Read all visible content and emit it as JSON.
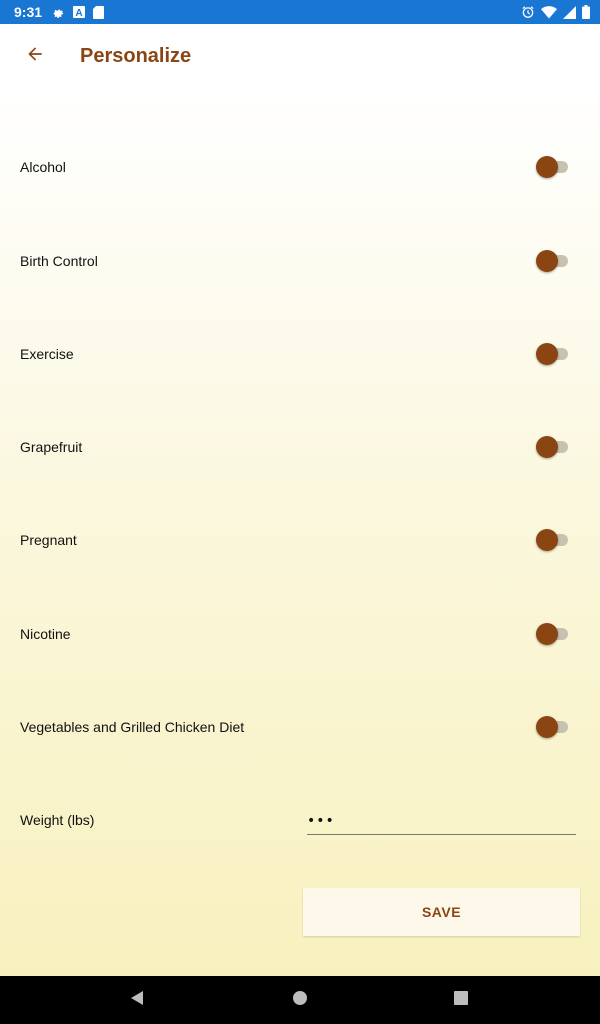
{
  "status_bar": {
    "time": "9:31",
    "left_icons": [
      "gear-icon",
      "a-badge-icon",
      "sd-card-icon"
    ],
    "right_icons": [
      "alarm-icon",
      "wifi-icon",
      "cell-signal-icon",
      "battery-icon"
    ]
  },
  "app_bar": {
    "back_icon": "arrow-back-icon",
    "title": "Personalize"
  },
  "settings": [
    {
      "label": "Alcohol",
      "on": false
    },
    {
      "label": "Birth Control",
      "on": false
    },
    {
      "label": "Exercise",
      "on": false
    },
    {
      "label": "Grapefruit",
      "on": false
    },
    {
      "label": "Pregnant",
      "on": false
    },
    {
      "label": "Nicotine",
      "on": false
    },
    {
      "label": "Vegetables and Grilled Chicken Diet",
      "on": false
    }
  ],
  "weight": {
    "label": "Weight (lbs)",
    "value": "•••"
  },
  "save_label": "SAVE",
  "nav_bar": {
    "buttons": [
      "back-triangle-icon",
      "home-circle-icon",
      "recents-square-icon"
    ]
  },
  "colors": {
    "accent": "#8b4513",
    "status_bar": "#1976d2",
    "switch_track": "#c7c2b0"
  }
}
